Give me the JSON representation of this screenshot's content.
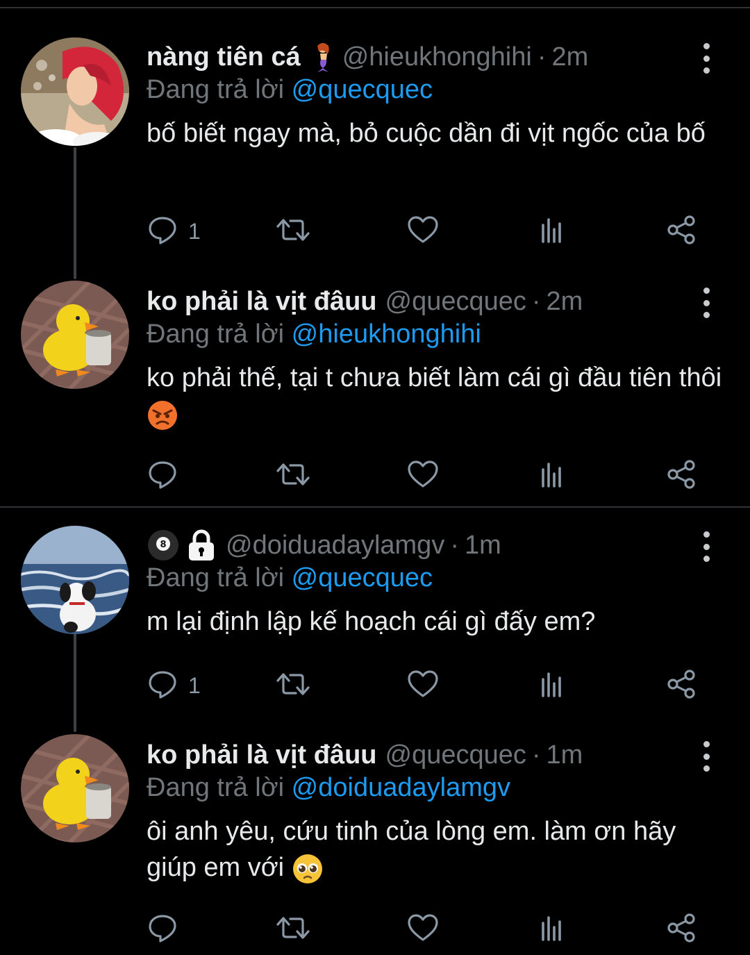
{
  "tweets": [
    {
      "name": "nàng tiên cá",
      "name_emoji": "mermaid",
      "handle": "@hieukhonghihi",
      "time": "2m",
      "reply_prefix": "Đang trả lời",
      "reply_to": "@quecquec",
      "body": "bố biết ngay mà, bỏ cuộc dần đi vịt ngốc của bố",
      "reply_count": "1",
      "avatar": "mermaid-avatar"
    },
    {
      "name": "ko phải là vịt đâuu",
      "handle": "@quecquec",
      "time": "2m",
      "reply_prefix": "Đang trả lời",
      "reply_to": "@hieukhonghihi",
      "body": "ko phải thế, tại t chưa biết làm cái gì đầu tiên thôi",
      "body_emoji": "angry-face",
      "reply_count": "",
      "avatar": "duck-avatar"
    },
    {
      "name_emoji": "8-ball + lock",
      "handle": "@doiduadaylamgv",
      "time": "1m",
      "reply_prefix": "Đang trả lời",
      "reply_to": "@quecquec",
      "body": "m lại định lập kế hoạch cái gì đấy em?",
      "reply_count": "1",
      "avatar": "sea-dog-avatar"
    },
    {
      "name": "ko phải là vịt đâuu",
      "handle": "@quecquec",
      "time": "1m",
      "reply_prefix": "Đang trả lời",
      "reply_to": "@doiduadaylamgv",
      "body": "ôi anh yêu, cứu tinh của lòng em. làm ơn hãy giúp em với",
      "body_emoji": "pleading-face",
      "reply_count": "",
      "avatar": "duck-avatar"
    }
  ],
  "colors": {
    "background": "#000000",
    "text": "#e7e9ea",
    "muted": "#71767b",
    "mention": "#1d9bf0",
    "icon": "#8b98a5"
  },
  "icons": [
    "reply-icon",
    "retweet-icon",
    "like-icon",
    "views-icon",
    "share-icon",
    "more-icon"
  ],
  "dot_separator": "·"
}
